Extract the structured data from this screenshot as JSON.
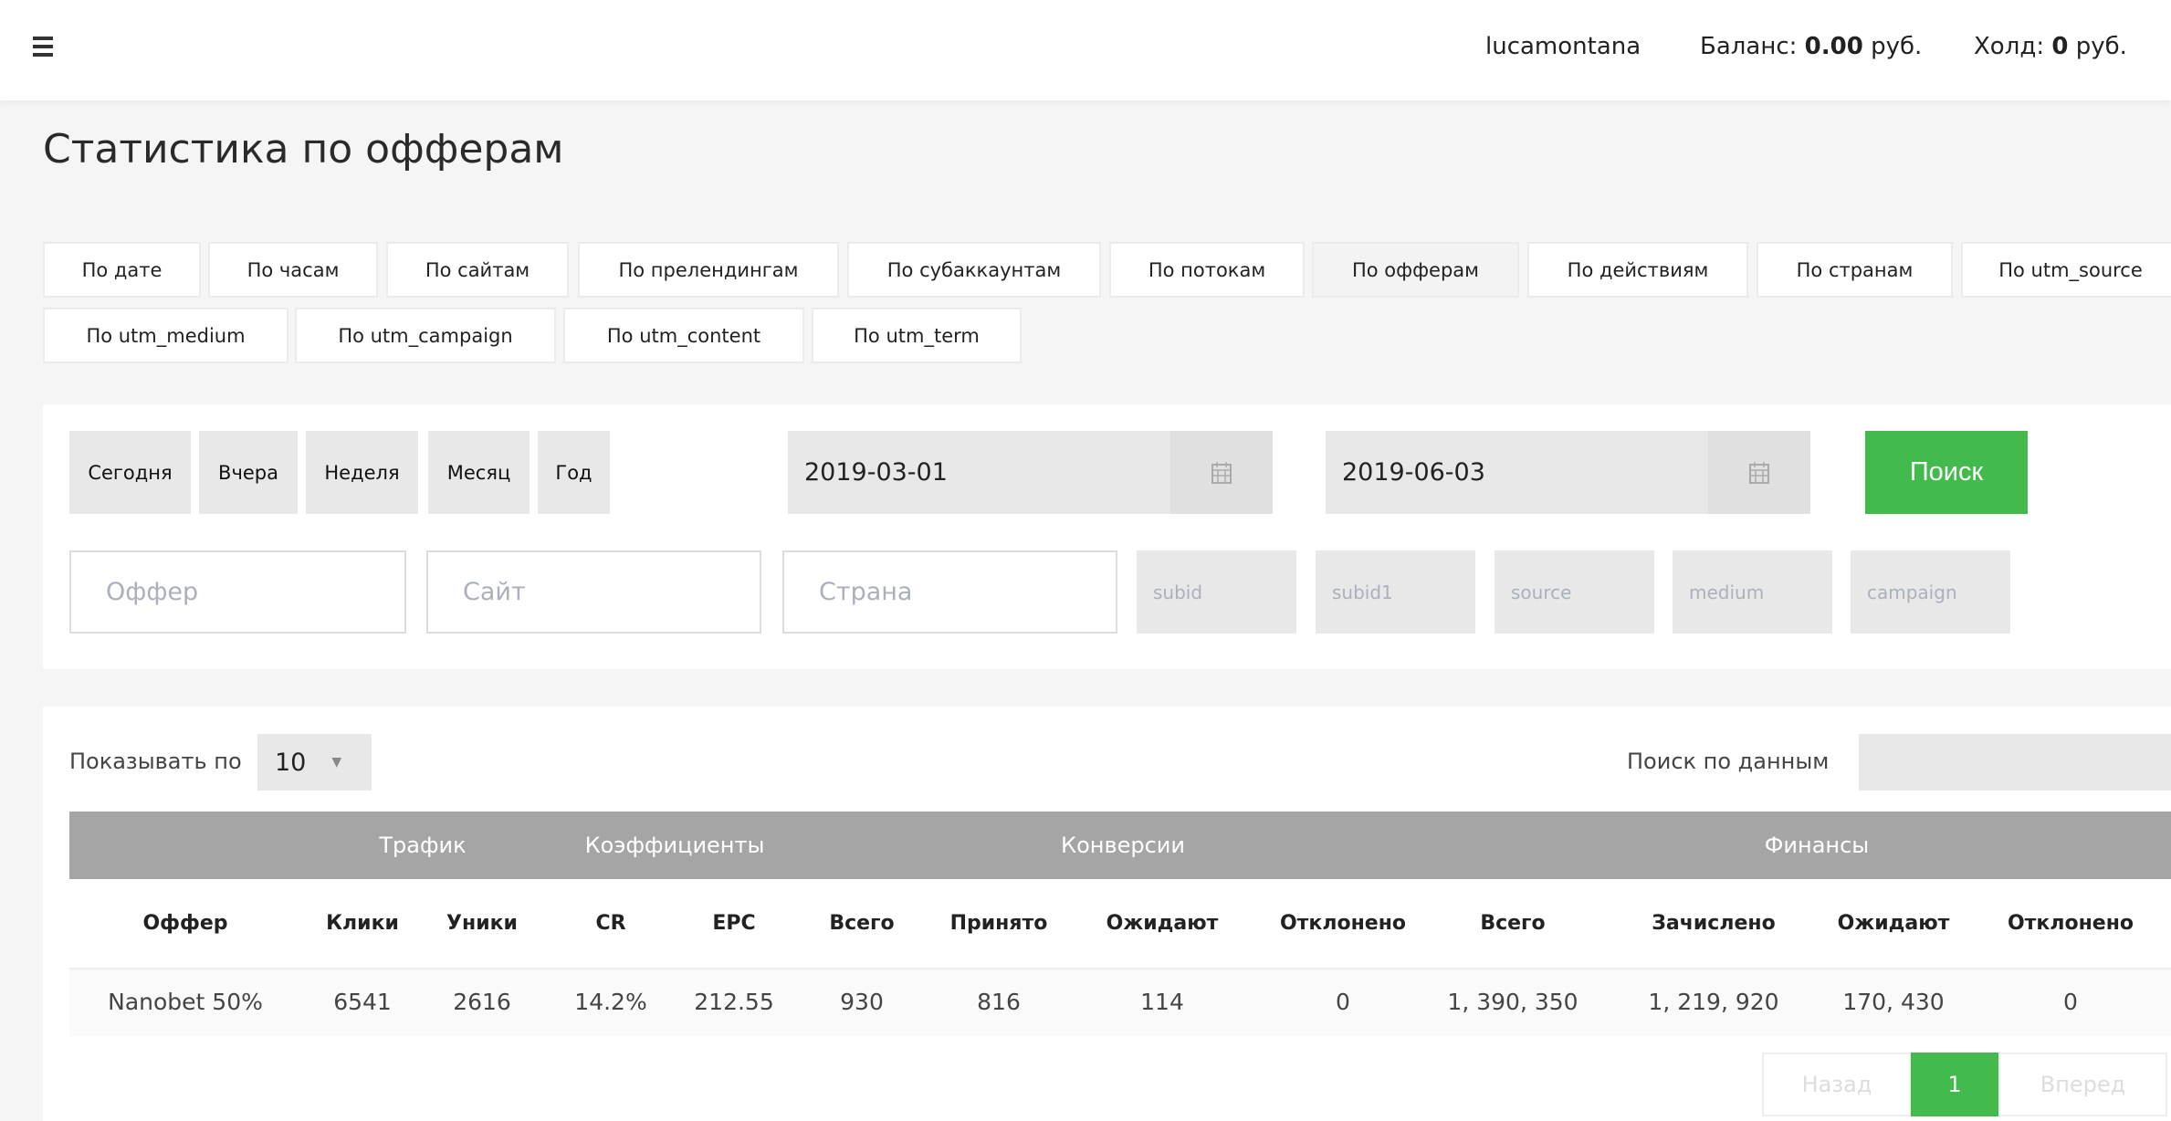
{
  "header": {
    "username": "lucamontana",
    "balance_label": "Баланс:",
    "balance_value": "0.00",
    "balance_unit": "руб.",
    "hold_label": "Холд:",
    "hold_value": "0",
    "hold_unit": "руб."
  },
  "page_title": "Статистика по офферам",
  "tabs": [
    {
      "label": "По дате"
    },
    {
      "label": "По часам"
    },
    {
      "label": "По сайтам"
    },
    {
      "label": "По прелендингам"
    },
    {
      "label": "По субаккаунтам"
    },
    {
      "label": "По потокам"
    },
    {
      "label": "По офферам",
      "active": true
    },
    {
      "label": "По действиям"
    },
    {
      "label": "По странам"
    },
    {
      "label": "По utm_source"
    },
    {
      "label": "По utm_medium"
    },
    {
      "label": "По utm_campaign"
    },
    {
      "label": "По utm_content"
    },
    {
      "label": "По utm_term"
    }
  ],
  "filters": {
    "quick": [
      "Сегодня",
      "Вчера",
      "Неделя",
      "Месяц",
      "Год"
    ],
    "date_from": "2019-03-01",
    "date_to": "2019-06-03",
    "search_label": "Поиск",
    "inputs": [
      "Оффер",
      "Сайт",
      "Страна"
    ],
    "small_inputs": [
      "subid",
      "subid1",
      "source",
      "medium",
      "campaign"
    ]
  },
  "table_controls": {
    "show_label": "Показывать по",
    "page_size": "10",
    "search_label": "Поиск по данным"
  },
  "table": {
    "groups": [
      "Трафик",
      "Коэффициенты",
      "Конверсии",
      "Финансы"
    ],
    "columns": [
      "Оффер",
      "Клики",
      "Уники",
      "CR",
      "EPC",
      "Всего",
      "Принято",
      "Ожидают",
      "Отклонено",
      "Всего",
      "Зачислено",
      "Ожидают",
      "Отклонено"
    ],
    "rows": [
      [
        "Nanobet 50%",
        "6541",
        "2616",
        "14.2%",
        "212.55",
        "930",
        "816",
        "114",
        "0",
        "1, 390, 350",
        "1, 219, 920",
        "170, 430",
        "0"
      ]
    ]
  },
  "pagination": {
    "prev": "Назад",
    "current": "1",
    "next": "Вперед"
  },
  "colors": {
    "accent": "#43bb4c",
    "table_header": "#a5a5a5"
  }
}
